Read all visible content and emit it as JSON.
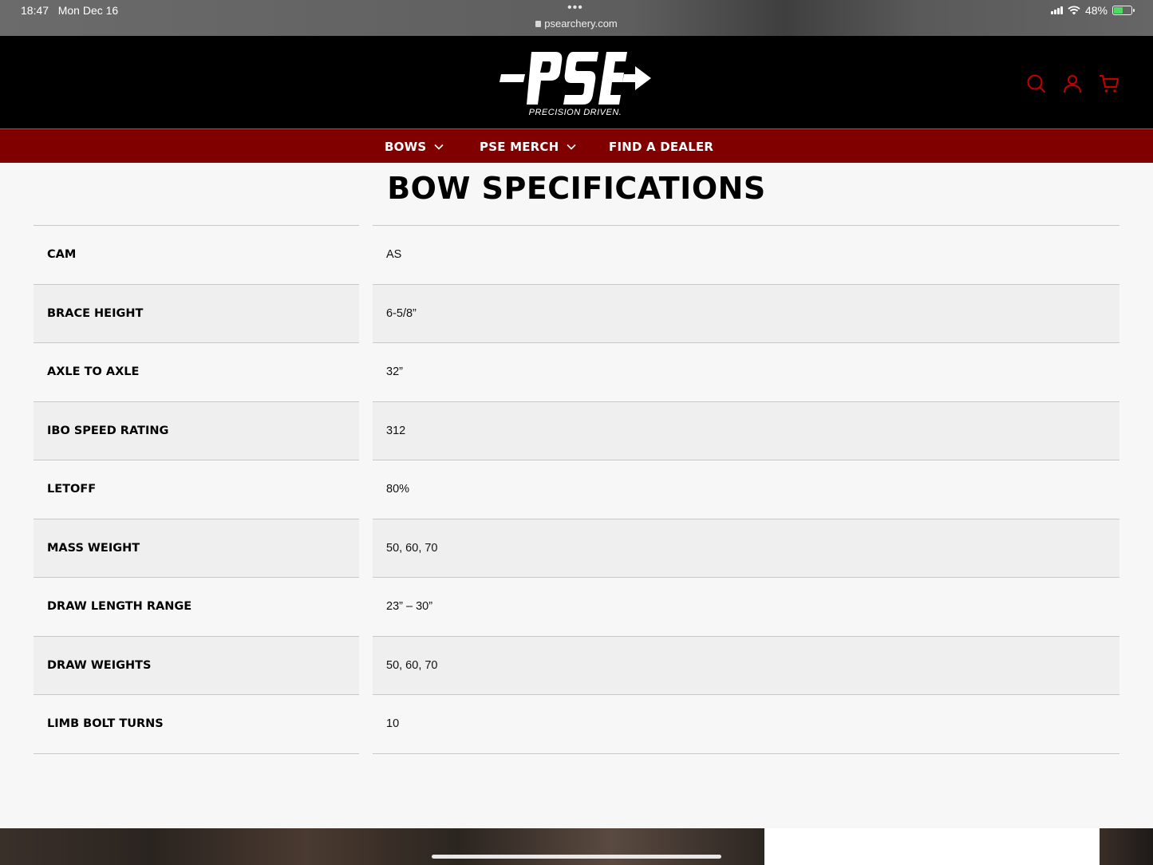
{
  "status_bar": {
    "time": "18:47",
    "date": "Mon Dec 16",
    "url": "psearchery.com",
    "battery": "48%",
    "battery_level": 0.48
  },
  "header": {
    "logo_text": "PSE",
    "tagline": "PRECISION DRIVEN.",
    "icons": [
      "search-icon",
      "account-icon",
      "cart-icon"
    ],
    "icon_color": "#c40000"
  },
  "nav": {
    "items": [
      {
        "label": "BOWS",
        "has_dropdown": true
      },
      {
        "label": "PSE MERCH",
        "has_dropdown": true
      },
      {
        "label": "FIND A DEALER",
        "has_dropdown": false
      }
    ],
    "background": "#800000"
  },
  "main": {
    "title": "BOW SPECIFICATIONS",
    "specs": [
      {
        "label": "CAM",
        "value": "AS"
      },
      {
        "label": "BRACE HEIGHT",
        "value": "6-5/8”"
      },
      {
        "label": "AXLE TO AXLE",
        "value": "32”"
      },
      {
        "label": "IBO SPEED RATING",
        "value": "312"
      },
      {
        "label": "LETOFF",
        "value": "80%"
      },
      {
        "label": "MASS WEIGHT",
        "value": "50, 60, 70"
      },
      {
        "label": "DRAW LENGTH RANGE",
        "value": "23” – 30”"
      },
      {
        "label": "DRAW WEIGHTS",
        "value": "50, 60, 70"
      },
      {
        "label": "LIMB BOLT TURNS",
        "value": "10"
      }
    ]
  }
}
